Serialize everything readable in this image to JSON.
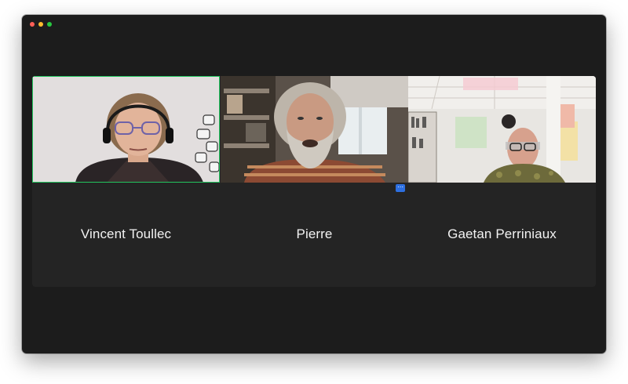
{
  "window": {
    "controls": [
      "close",
      "minimize",
      "zoom"
    ],
    "colors": {
      "background": "#1c1c1c",
      "grid": "#242424",
      "active_speaker_border": "#22c55e",
      "more_button": "#2d6fe0"
    }
  },
  "participants": [
    {
      "name": "Vincent Toullec",
      "active_speaker": true
    },
    {
      "name": "Pierre",
      "active_speaker": false
    },
    {
      "name": "Gaetan Perriniaux",
      "active_speaker": false
    }
  ],
  "more_options": {
    "icon": "ellipsis-icon",
    "glyph": "⋯"
  }
}
